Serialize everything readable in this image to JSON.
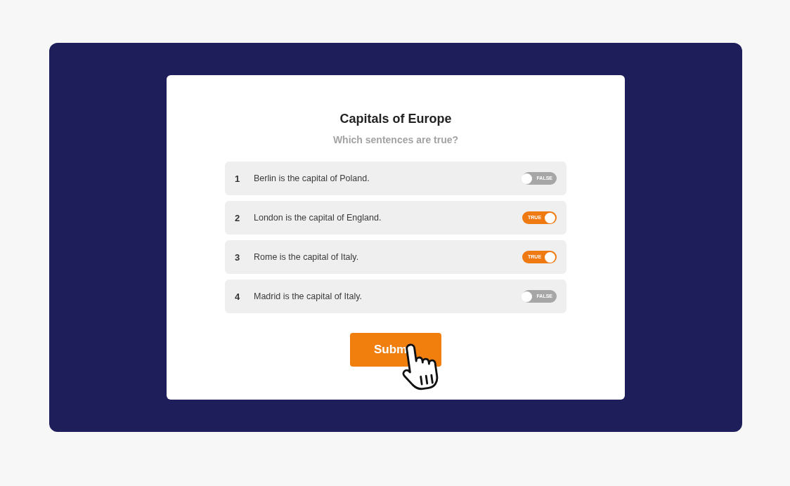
{
  "quiz": {
    "title": "Capitals of Europe",
    "subtitle": "Which sentences are true?",
    "statements": [
      {
        "number": "1",
        "text": "Berlin is the capital of Poland.",
        "on": false,
        "toggle_label": "FALSE"
      },
      {
        "number": "2",
        "text": "London is the capital of England.",
        "on": true,
        "toggle_label": "TRUE"
      },
      {
        "number": "3",
        "text": "Rome is the capital of Italy.",
        "on": true,
        "toggle_label": "TRUE"
      },
      {
        "number": "4",
        "text": "Madrid is the capital of Italy.",
        "on": false,
        "toggle_label": "FALSE"
      }
    ],
    "submit_button": "Subm"
  }
}
